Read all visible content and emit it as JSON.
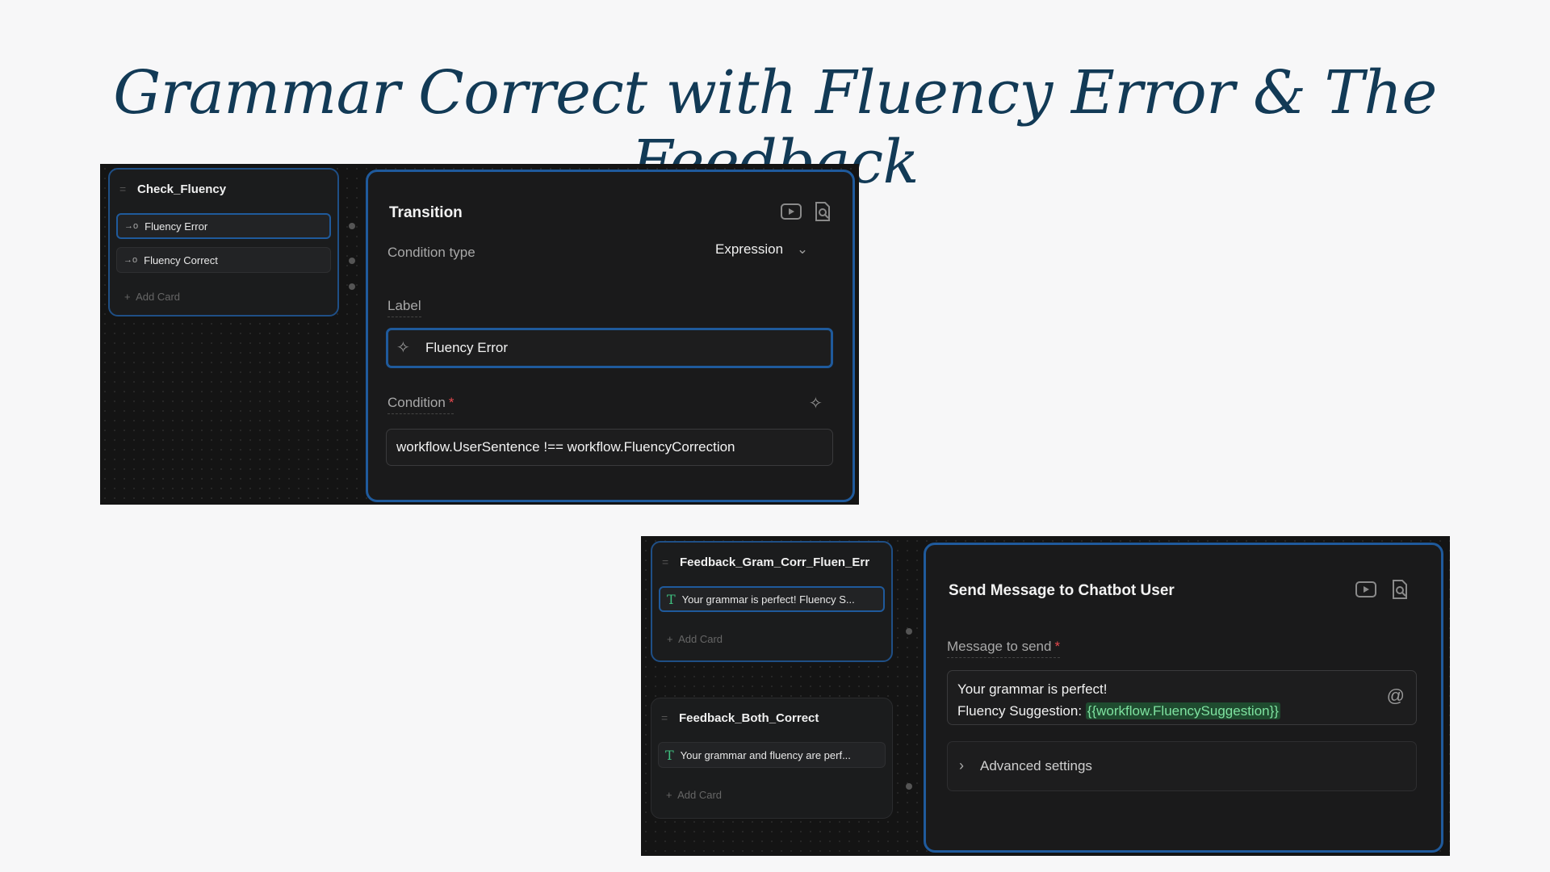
{
  "slide": {
    "title": "Grammar Correct with Fluency Error & The Feedback"
  },
  "screenshot1": {
    "node": {
      "title": "Check_Fluency",
      "cards": [
        "Fluency Error",
        "Fluency Correct"
      ],
      "add_card": "Add Card"
    },
    "panel": {
      "title": "Transition",
      "condition_type_label": "Condition type",
      "condition_type_value": "Expression",
      "label_label": "Label",
      "label_value": "Fluency Error",
      "condition_label": "Condition",
      "condition_value": "workflow.UserSentence !== workflow.FluencyCorrection"
    }
  },
  "screenshot2": {
    "node1": {
      "title": "Feedback_Gram_Corr_Fluen_Err",
      "card": "Your grammar is perfect! Fluency S...",
      "add_card": "Add Card"
    },
    "node2": {
      "title": "Feedback_Both_Correct",
      "card": "Your grammar and fluency are perf...",
      "add_card": "Add Card"
    },
    "panel": {
      "title": "Send Message to Chatbot User",
      "message_label": "Message to send",
      "message_line1": "Your grammar is perfect!",
      "message_line2_prefix": "Fluency Suggestion: ",
      "message_variable": "{{workflow.FluencySuggestion}}",
      "advanced_settings": "Advanced settings"
    }
  },
  "icons": {
    "play": "play-icon",
    "inspect": "inspect-icon",
    "sparkle": "sparkle-icon",
    "chevron_down": "chevron-down-icon",
    "chevron_right": "chevron-right-icon",
    "mention": "at-mention-icon",
    "drag": "drag-handle-icon",
    "transition": "transition-icon",
    "text": "text-card-icon"
  },
  "colors": {
    "accent": "#1f5a9c",
    "title": "#123a56",
    "variable": "#7ee2a0"
  }
}
